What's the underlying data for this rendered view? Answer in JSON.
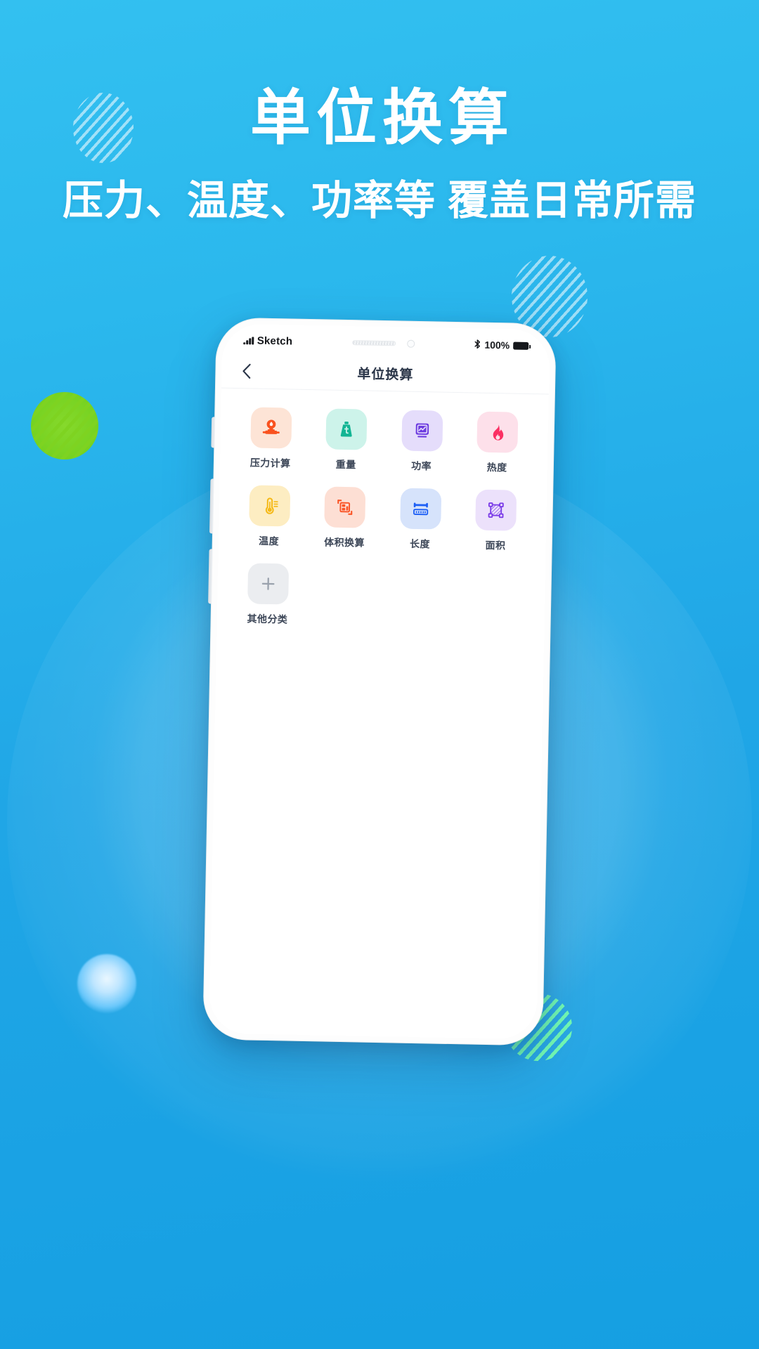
{
  "hero": {
    "title": "单位换算",
    "subtitle": "压力、温度、功率等 覆盖日常所需"
  },
  "phone": {
    "status_bar": {
      "carrier": "Sketch",
      "signal_icon": "signal-bars-icon",
      "bluetooth_icon": "bluetooth-icon",
      "bluetooth_glyph": "�ливо",
      "battery_percent": "100%",
      "battery_icon": "battery-full-icon"
    },
    "nav": {
      "back_icon": "chevron-left-icon",
      "title": "单位换算"
    },
    "grid": {
      "items": [
        {
          "label": "压力计算",
          "icon": "pressure-gauge-icon",
          "tile_bg": "#fde4d6",
          "fg": "#f9521f"
        },
        {
          "label": "重量",
          "icon": "weight-icon",
          "tile_bg": "#cdf3ea",
          "fg": "#13b594"
        },
        {
          "label": "功率",
          "icon": "power-chart-icon",
          "tile_bg": "#e5ddfb",
          "fg": "#6d3ce0"
        },
        {
          "label": "热度",
          "icon": "flame-icon",
          "tile_bg": "#fde0ea",
          "fg": "#fb2f63"
        },
        {
          "label": "温度",
          "icon": "thermometer-icon",
          "tile_bg": "#fdedc2",
          "fg": "#f5b916"
        },
        {
          "label": "体积换算",
          "icon": "volume-grid-icon",
          "tile_bg": "#fddfd4",
          "fg": "#fa5425"
        },
        {
          "label": "长度",
          "icon": "ruler-icon",
          "tile_bg": "#d6e3fb",
          "fg": "#1d5ff5"
        },
        {
          "label": "面积",
          "icon": "area-icon",
          "tile_bg": "#ece1fb",
          "fg": "#7b3ce8"
        },
        {
          "label": "其他分类",
          "icon": "plus-icon",
          "tile_bg": "#ebedf0",
          "fg": "#9aa2ad"
        }
      ]
    }
  },
  "colors": {
    "brand_blue": "#1fa8e8",
    "bg_top": "#33c0f0",
    "bg_bottom": "#159fe2",
    "green_dot": "#7ed321",
    "mint_dot": "#5fe7b0",
    "orange_dot": "#ffab2e",
    "text_white": "#ffffff"
  }
}
